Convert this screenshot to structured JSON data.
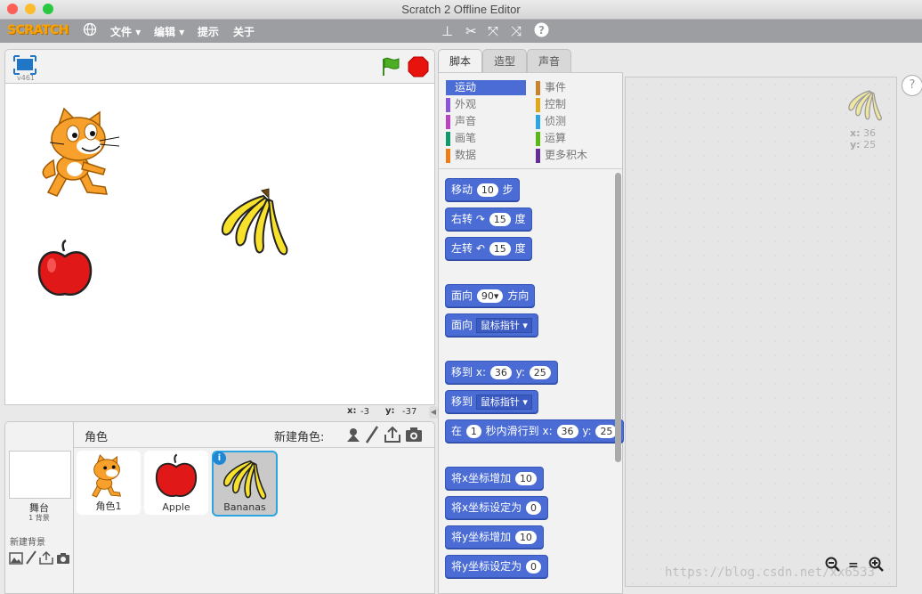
{
  "window": {
    "title": "Scratch 2 Offline Editor"
  },
  "menubar": {
    "logo": "SCRATCH",
    "file": "文件",
    "edit": "编辑",
    "tips": "提示",
    "about": "关于"
  },
  "stage": {
    "version": "v461",
    "mouse_x_label": "x:",
    "mouse_x": "-3",
    "mouse_y_label": "y:",
    "mouse_y": "-37"
  },
  "sprites_pane": {
    "title": "角色",
    "new_sprite_label": "新建角色:",
    "stage_label": "舞台",
    "stage_backdrops": "1 背景",
    "new_backdrop_label": "新建背景",
    "sprites": [
      {
        "name": "角色1"
      },
      {
        "name": "Apple"
      },
      {
        "name": "Bananas"
      }
    ]
  },
  "tabs": {
    "scripts": "脚本",
    "costumes": "造型",
    "sounds": "声音"
  },
  "categories": [
    {
      "label": "运动",
      "color": "#4a6cd4"
    },
    {
      "label": "外观",
      "color": "#8a55d7"
    },
    {
      "label": "声音",
      "color": "#bb42c3"
    },
    {
      "label": "画笔",
      "color": "#0e9a6c"
    },
    {
      "label": "数据",
      "color": "#ee7d16"
    },
    {
      "label": "事件",
      "color": "#c88330"
    },
    {
      "label": "控制",
      "color": "#e1a91a"
    },
    {
      "label": "侦测",
      "color": "#2ca5e2"
    },
    {
      "label": "运算",
      "color": "#5cb712"
    },
    {
      "label": "更多积木",
      "color": "#632d99"
    }
  ],
  "blocks": {
    "move": {
      "a": "移动",
      "n": "10",
      "b": "步"
    },
    "turn_right": {
      "a": "右转",
      "n": "15",
      "b": "度"
    },
    "turn_left": {
      "a": "左转",
      "n": "15",
      "b": "度"
    },
    "point_dir": {
      "a": "面向",
      "n": "90",
      "b": "方向"
    },
    "point_towards": {
      "a": "面向",
      "d": "鼠标指针"
    },
    "goto_xy": {
      "a": "移到",
      "x": "x:",
      "xv": "36",
      "y": "y:",
      "yv": "25"
    },
    "goto": {
      "a": "移到",
      "d": "鼠标指针"
    },
    "glide": {
      "a": "在",
      "n": "1",
      "b": "秒内滑行到",
      "x": "x:",
      "xv": "36",
      "y": "y:",
      "yv": "25"
    },
    "change_x": {
      "a": "将x坐标增加",
      "n": "10"
    },
    "set_x": {
      "a": "将x坐标设定为",
      "n": "0"
    },
    "change_y": {
      "a": "将y坐标增加",
      "n": "10"
    },
    "set_y": {
      "a": "将y坐标设定为",
      "n": "0"
    }
  },
  "script_area": {
    "sprite_x_label": "x:",
    "sprite_x": "36",
    "sprite_y_label": "y:",
    "sprite_y": "25",
    "watermark": "https://blog.csdn.net/xx6533"
  },
  "colors": {
    "accent": "#4a6cd4",
    "selected_border": "#2ba4e0"
  }
}
